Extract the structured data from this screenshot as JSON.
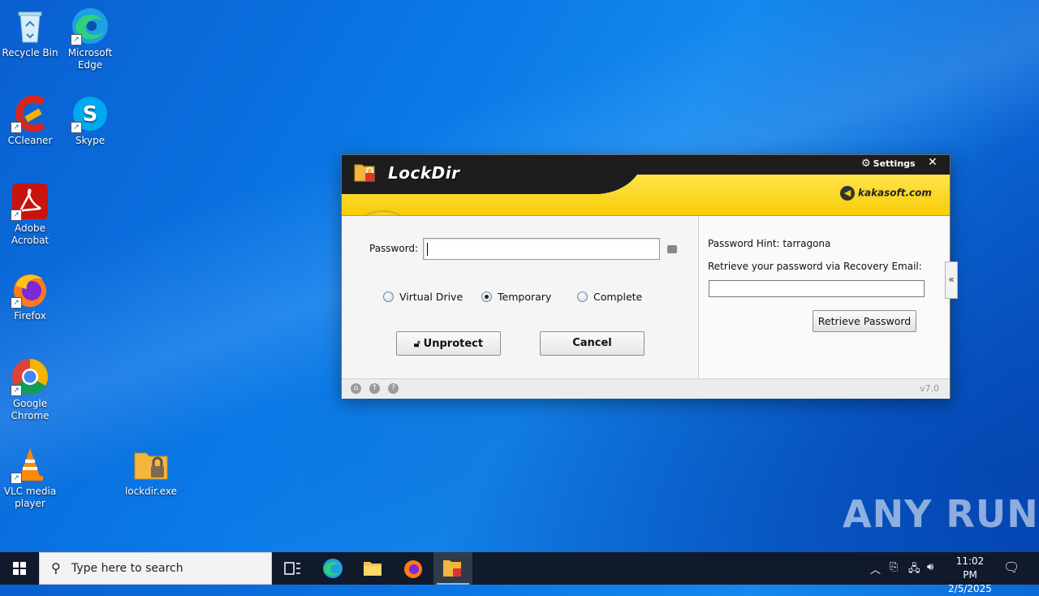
{
  "desktop": {
    "icons": [
      {
        "label": "Recycle Bin"
      },
      {
        "label": "Microsoft Edge"
      },
      {
        "label": "CCleaner"
      },
      {
        "label": "Skype"
      },
      {
        "label": "Adobe Acrobat"
      },
      {
        "label": "Firefox"
      },
      {
        "label": "Google Chrome"
      },
      {
        "label": "VLC media player"
      },
      {
        "label": "lockdir.exe"
      }
    ],
    "watermark": "ANY RUN"
  },
  "window": {
    "title": "LockDir",
    "settings_label": "Settings",
    "close_label": "✕",
    "brand": "kakasoft.com",
    "password_label": "Password:",
    "password_value": "",
    "modes": [
      {
        "label": "Virtual Drive",
        "selected": false
      },
      {
        "label": "Temporary",
        "selected": true
      },
      {
        "label": "Complete",
        "selected": false
      }
    ],
    "unprotect_label": "Unprotect",
    "cancel_label": "Cancel",
    "hint_label": "Password Hint: tarragona",
    "retrieve_label": "Retrieve your password via Recovery Email:",
    "email_value": "",
    "retrieve_button": "Retrieve Password",
    "collapse_label": "«",
    "version": "v7.0"
  },
  "taskbar": {
    "search_placeholder": "Type here to search",
    "time": "11:02 PM",
    "date": "2/5/2025"
  },
  "colors": {
    "header_yellow": "#f7cc08",
    "header_dark": "#1d1d1d",
    "taskbar": "#101a2b"
  }
}
